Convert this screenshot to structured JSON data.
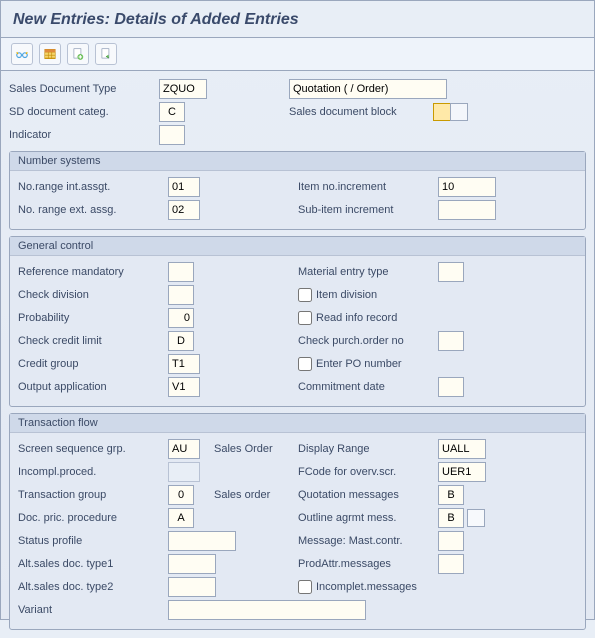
{
  "title": "New Entries: Details of Added Entries",
  "toolbar": {
    "items": [
      "glasses",
      "table",
      "page-plus",
      "page-arrow"
    ]
  },
  "top": {
    "sales_doc_type_lbl": "Sales Document Type",
    "sales_doc_type_val": "ZQUO",
    "sales_doc_type_desc": "Quotation ( / Order)",
    "sd_doc_categ_lbl": "SD document categ.",
    "sd_doc_categ_val": "C",
    "sales_doc_block_lbl": "Sales document block",
    "indicator_lbl": "Indicator",
    "indicator_val": ""
  },
  "panels": {
    "numsys": {
      "title": "Number systems",
      "no_range_int_lbl": "No.range int.assgt.",
      "no_range_int_val": "01",
      "item_no_inc_lbl": "Item no.increment",
      "item_no_inc_val": "10",
      "no_range_ext_lbl": "No. range ext. assg.",
      "no_range_ext_val": "02",
      "sub_item_inc_lbl": "Sub-item increment",
      "sub_item_inc_val": ""
    },
    "general": {
      "title": "General control",
      "ref_mandatory_lbl": "Reference mandatory",
      "ref_mandatory_val": "",
      "material_entry_lbl": "Material entry type",
      "check_division_lbl": "Check division",
      "check_division_val": "",
      "item_division_lbl": "Item division",
      "probability_lbl": "Probability",
      "probability_val": "0",
      "read_info_rec_lbl": "Read info record",
      "check_credit_lbl": "Check credit limit",
      "check_credit_val": "D",
      "check_po_lbl": "Check purch.order no",
      "credit_group_lbl": "Credit group",
      "credit_group_val": "T1",
      "enter_po_lbl": "Enter PO number",
      "output_app_lbl": "Output application",
      "output_app_val": "V1",
      "commit_date_lbl": "Commitment  date",
      "commit_date_val": ""
    },
    "tflow": {
      "title": "Transaction flow",
      "screen_seq_lbl": "Screen sequence grp.",
      "screen_seq_val": "AU",
      "screen_seq_desc": "Sales Order",
      "display_range_lbl": "Display Range",
      "display_range_val": "UALL",
      "incompl_proc_lbl": "Incompl.proced.",
      "fcode_lbl": "FCode for overv.scr.",
      "fcode_val": "UER1",
      "trans_group_lbl": "Transaction group",
      "trans_group_val": "0",
      "trans_group_desc": "Sales order",
      "quot_msg_lbl": "Quotation messages",
      "quot_msg_val": "B",
      "doc_pric_lbl": "Doc. pric. procedure",
      "doc_pric_val": "A",
      "outline_msg_lbl": "Outline agrmt mess.",
      "outline_msg_val": "B",
      "status_profile_lbl": "Status profile",
      "status_profile_val": "",
      "msg_mastcontr_lbl": "Message: Mast.contr.",
      "alt1_lbl": "Alt.sales doc. type1",
      "alt1_val": "",
      "prodattr_lbl": "ProdAttr.messages",
      "alt2_lbl": "Alt.sales doc. type2",
      "alt2_val": "",
      "incomplet_msg_lbl": "Incomplet.messages",
      "variant_lbl": "Variant",
      "variant_val": ""
    }
  }
}
